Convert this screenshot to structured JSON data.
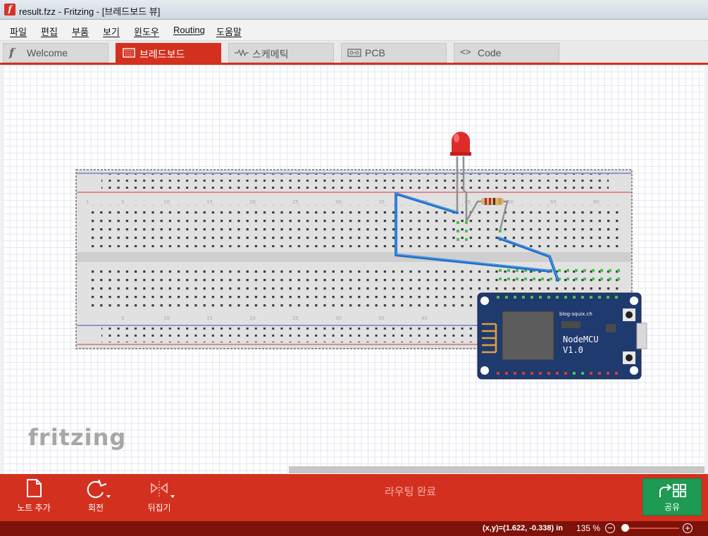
{
  "window": {
    "title": "result.fzz - Fritzing - [브레드보드 뷰]",
    "app_icon": "f"
  },
  "menu": [
    "파일",
    "편집",
    "부품",
    "보기",
    "윈도우",
    "Routing",
    "도움말"
  ],
  "tabs": [
    {
      "label": "Welcome",
      "icon": "fritzing-f-icon",
      "active": false
    },
    {
      "label": "브레드보드",
      "icon": "breadboard-icon",
      "active": true
    },
    {
      "label": "스케메틱",
      "icon": "schematic-icon",
      "active": false
    },
    {
      "label": "PCB",
      "icon": "pcb-icon",
      "active": false
    },
    {
      "label": "Code",
      "icon": "code-icon",
      "active": false
    }
  ],
  "canvas": {
    "logo": "fritzing",
    "breadboard_column_labels": [
      "1",
      "5",
      "10",
      "15",
      "20",
      "25",
      "30",
      "35",
      "40",
      "45",
      "50",
      "55",
      "60"
    ],
    "nodemcu": {
      "site": "blog-squix.ch",
      "name": "NodeMCU",
      "version": "V1.0"
    }
  },
  "toolbar": {
    "add_note": "노트 추가",
    "rotate": "회전",
    "flip": "뒤집기",
    "routing_status": "라우팅 완료",
    "share": "공유"
  },
  "status": {
    "coords": "(x,y)=(1.622, -0.338) in",
    "zoom": "135 %"
  },
  "colors": {
    "accent": "#d4301f",
    "share": "#1e9a52",
    "wire": "#1f6fc8"
  }
}
